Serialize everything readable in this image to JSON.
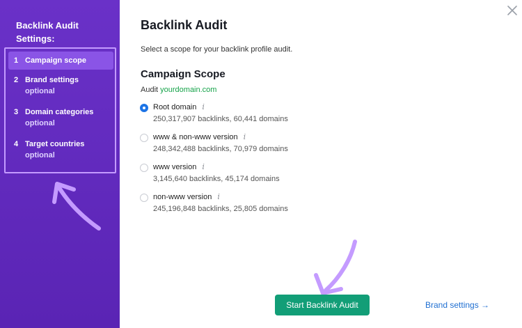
{
  "sidebar": {
    "title": "Backlink Audit Settings:",
    "steps": [
      {
        "num": "1",
        "label": "Campaign scope",
        "sub": ""
      },
      {
        "num": "2",
        "label": "Brand settings",
        "sub": "optional"
      },
      {
        "num": "3",
        "label": "Domain categories",
        "sub": "optional"
      },
      {
        "num": "4",
        "label": "Target countries",
        "sub": "optional"
      }
    ]
  },
  "main": {
    "title": "Backlink Audit",
    "subtitle": "Select a scope for your backlink profile audit.",
    "section_title": "Campaign Scope",
    "audit_prefix": "Audit",
    "audit_domain": "yourdomain.com",
    "options": [
      {
        "label": "Root domain",
        "info": "i",
        "meta": "250,317,907 backlinks, 60,441 domains",
        "selected": true
      },
      {
        "label": "www & non-www version",
        "info": "i",
        "meta": "248,342,488 backlinks, 70,979 domains",
        "selected": false
      },
      {
        "label": "www version",
        "info": "i",
        "meta": "3,145,640 backlinks, 45,174 domains",
        "selected": false
      },
      {
        "label": "non-www version",
        "info": "i",
        "meta": "245,196,848 backlinks, 25,805 domains",
        "selected": false
      }
    ],
    "start_button": "Start Backlink Audit",
    "next_link": "Brand settings →"
  },
  "colors": {
    "sidebar_bg": "#6a31c8",
    "accent_radio": "#1d74e6",
    "button_green": "#129e77",
    "link_blue": "#1f6fd1",
    "annotation_purple": "#c49bff"
  }
}
